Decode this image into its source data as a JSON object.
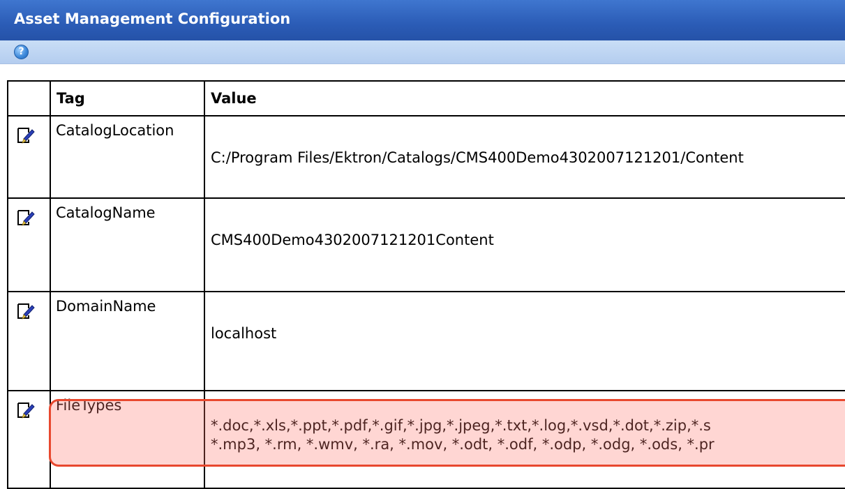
{
  "window": {
    "title": "Asset Management Configuration"
  },
  "toolbar": {
    "help_icon": "help-icon",
    "help_glyph": "?"
  },
  "table": {
    "headers": {
      "icon": "",
      "tag": "Tag",
      "value": "Value"
    },
    "rows": [
      {
        "tag": "CatalogLocation",
        "value": "C:/Program Files/Ektron/Catalogs/CMS400Demo4302007121201/Content",
        "value_line2": "",
        "icon": "edit-icon"
      },
      {
        "tag": "CatalogName",
        "value": "CMS400Demo4302007121201Content",
        "value_line2": "",
        "icon": "edit-icon"
      },
      {
        "tag": "DomainName",
        "value": "localhost",
        "value_line2": "",
        "icon": "edit-icon"
      },
      {
        "tag": "FileTypes",
        "value": "*.doc,*.xls,*.ppt,*.pdf,*.gif,*.jpg,*.jpeg,*.txt,*.log,*.vsd,*.dot,*.zip,*.s",
        "value_line2": "*.mp3, *.rm, *.wmv, *.ra, *.mov, *.odt, *.odf, *.odp, *.odg, *.ods, *.pr",
        "icon": "edit-icon",
        "highlighted": true
      }
    ]
  },
  "colors": {
    "titlebar": "#2b5cb6",
    "toolbar": "#c1d7f4",
    "highlight_border": "#e8482e",
    "highlight_fill": "#ffcfc9"
  }
}
